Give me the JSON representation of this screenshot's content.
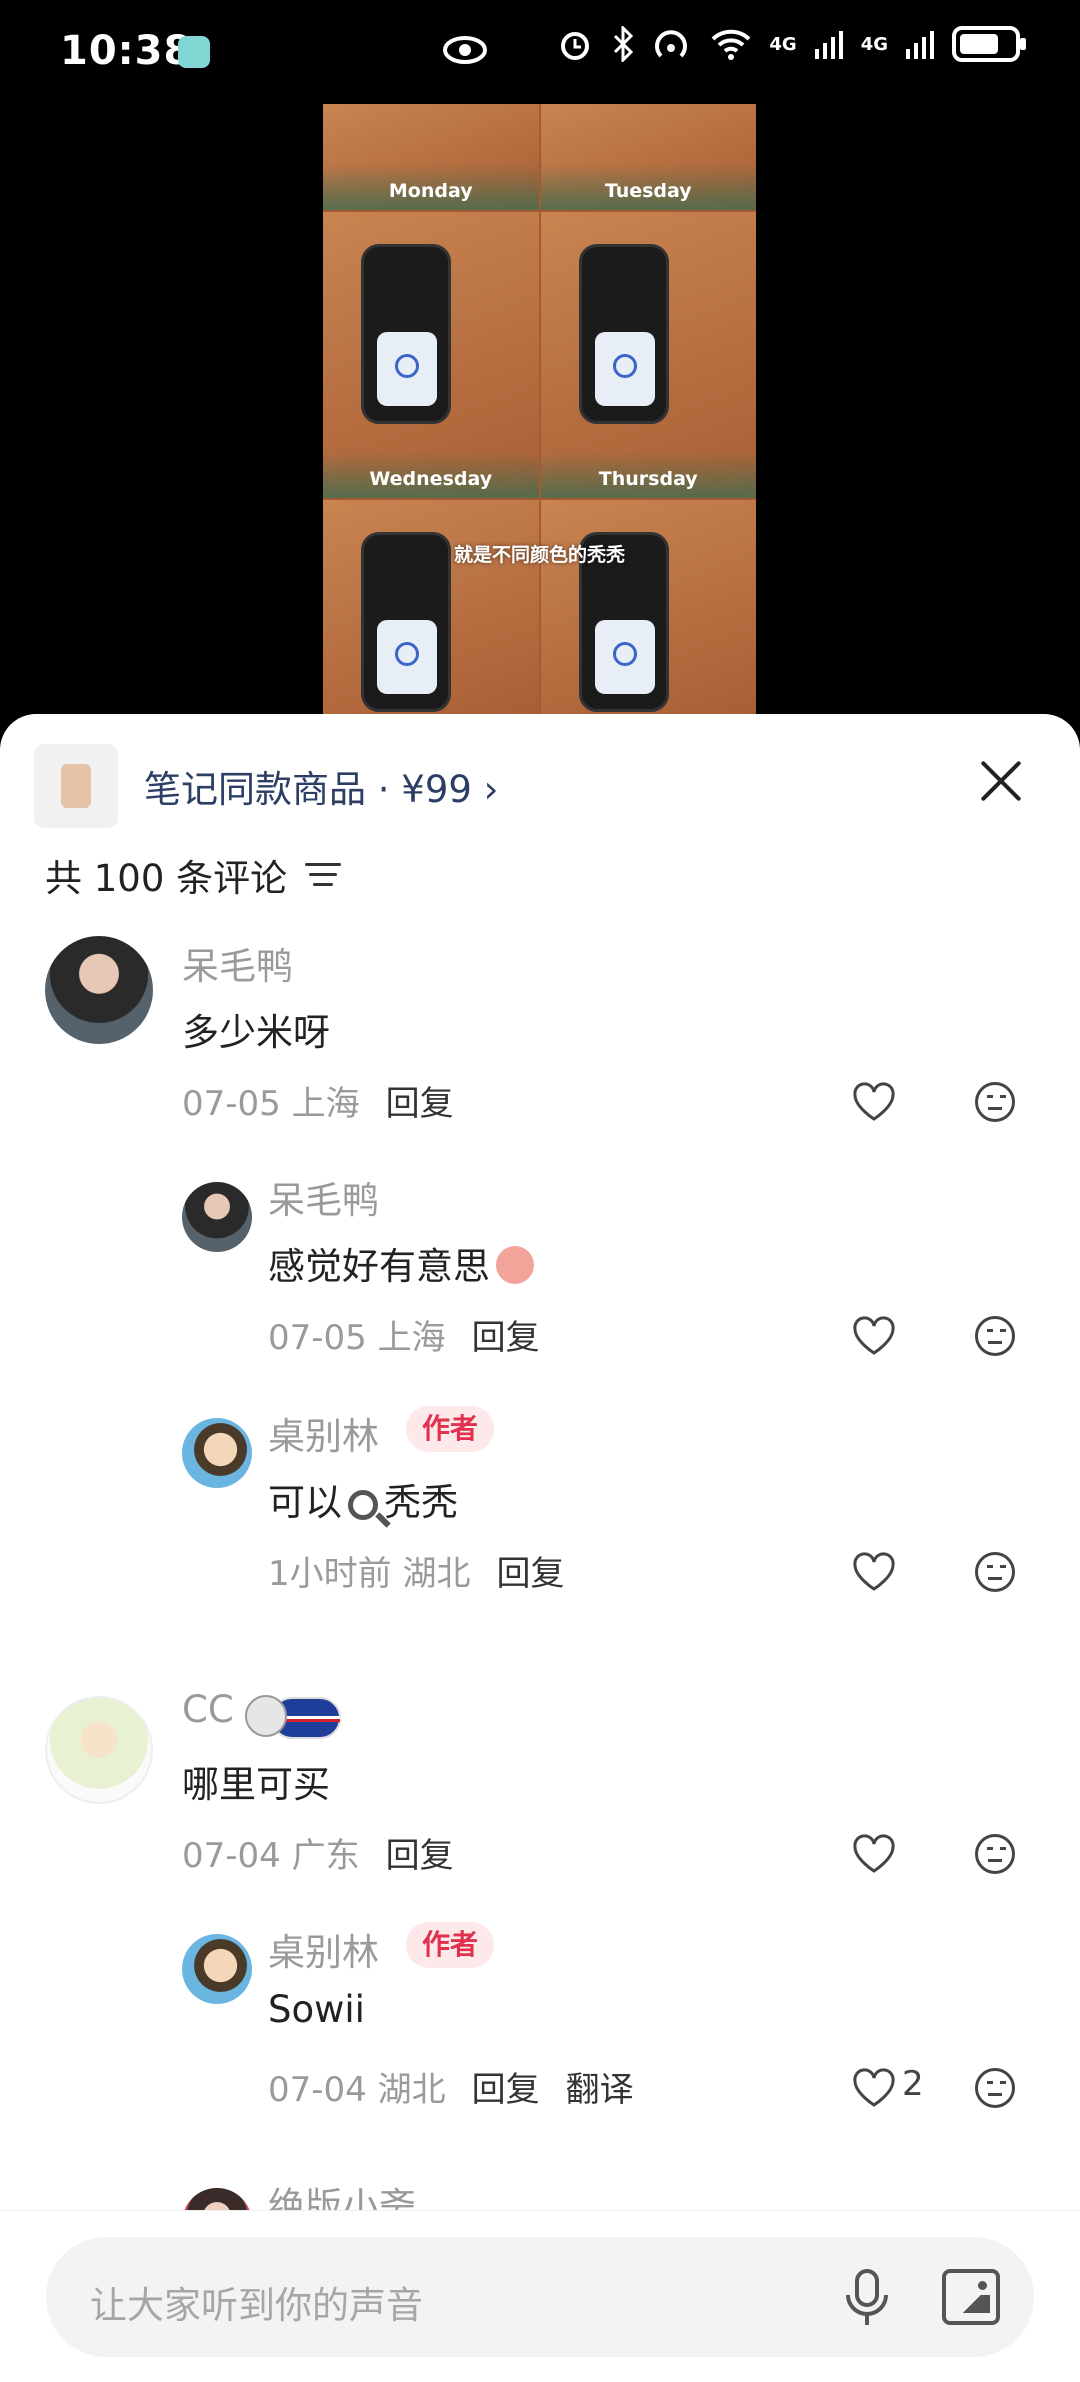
{
  "status_bar": {
    "time": "10:38",
    "network1": "4G",
    "network2": "4G",
    "icons": [
      "leaf-icon",
      "eye-icon",
      "alarm-icon",
      "bluetooth-icon",
      "hotspot-icon",
      "wifi-icon",
      "signal-icon",
      "battery-icon"
    ]
  },
  "video": {
    "days": [
      "Monday",
      "Tuesday",
      "Wednesday",
      "Thursday"
    ],
    "caption": "就是不同颜色的秃秃"
  },
  "product_bar": {
    "label": "笔记同款商品 · ¥99 ›"
  },
  "comments_header": {
    "count_label": "共 100 条评论"
  },
  "comments": [
    {
      "user": "呆毛鸭",
      "text": "多少米呀",
      "date": "07-05",
      "location": "上海",
      "reply": "回复"
    },
    {
      "user": "呆毛鸭",
      "text": "感觉好有意思",
      "date": "07-05",
      "location": "上海",
      "reply": "回复"
    },
    {
      "user": "桌别林",
      "badge": "作者",
      "text_pre": "可以",
      "text_post": "秃秃",
      "date": "1小时前",
      "location": "湖北",
      "reply": "回复"
    },
    {
      "user": "CC",
      "text": "哪里可买",
      "date": "07-04",
      "location": "广东",
      "reply": "回复"
    },
    {
      "user": "桌别林",
      "badge": "作者",
      "text": "Sowii",
      "date": "07-04",
      "location": "湖北",
      "reply": "回复",
      "translate": "翻译",
      "likes": "2"
    },
    {
      "user": "绝版小斋"
    }
  ],
  "input": {
    "placeholder": "让大家听到你的声音"
  },
  "colors": {
    "badge_bg": "#fde8ea",
    "badge_text": "#e0324e",
    "product_text": "#2c3e64"
  }
}
